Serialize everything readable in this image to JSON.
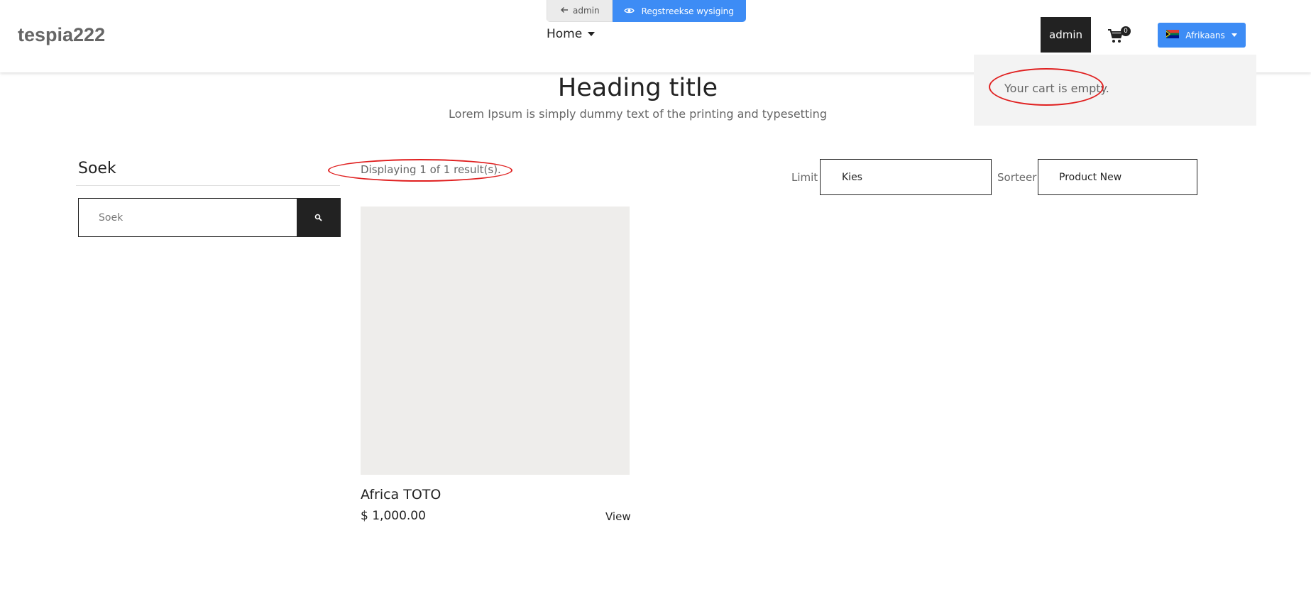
{
  "header": {
    "logo": "tespia222",
    "toolbar": {
      "back_label": "admin",
      "live_label": "Regstreekse wysiging"
    },
    "nav": {
      "home_label": "Home"
    },
    "admin_button": "admin",
    "cart": {
      "count": "0"
    },
    "language": {
      "label": "Afrikaans"
    }
  },
  "cart_dropdown": {
    "empty_text": "Your cart is empty."
  },
  "hero": {
    "title": "Heading title",
    "subtitle": "Lorem Ipsum is simply dummy text of the printing and typesetting"
  },
  "sidebar": {
    "title": "Soek",
    "search_placeholder": "Soek"
  },
  "listing": {
    "results_text": "Displaying 1 of 1 result(s).",
    "limit_label": "Limit",
    "limit_value": "Kies",
    "sort_label": "Sorteer",
    "sort_value": "Product New"
  },
  "products": [
    {
      "name": "Africa TOTO",
      "price": "$ 1,000.00",
      "view_label": "View"
    }
  ],
  "colors": {
    "accent_blue": "#3d8cf5",
    "dark": "#222222",
    "annotation_red": "#e02020",
    "image_placeholder": "#eeedeb"
  }
}
